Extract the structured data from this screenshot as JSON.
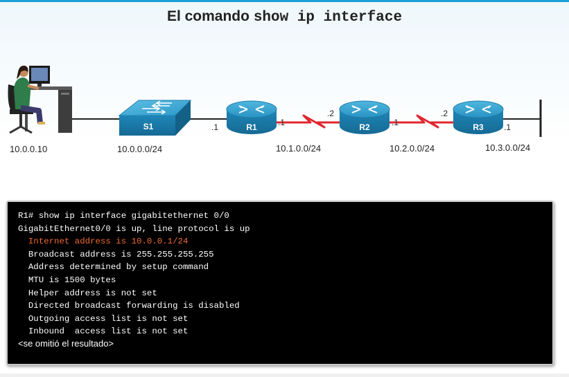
{
  "title": {
    "prefix": "El comando",
    "command": "show ip interface"
  },
  "devices": {
    "pc": {
      "address": "10.0.0.10"
    },
    "switch": {
      "label": "S1"
    },
    "routers": [
      {
        "label": "R1"
      },
      {
        "label": "R2"
      },
      {
        "label": "R3"
      }
    ]
  },
  "networks": [
    "10.0.0.0/24",
    "10.1.0.0/24",
    "10.2.0.0/24",
    "10.3.0.0/24"
  ],
  "interface_labels": {
    "r1_lan": ".1",
    "r1_wan": ".1",
    "r2_left": ".2",
    "r2_right": ".1",
    "r3_left": ".2",
    "r3_lan": ".1"
  },
  "terminal": {
    "lines": [
      {
        "text": "R1# show ip interface gigabitethernet 0/0",
        "style": "normal"
      },
      {
        "text": "GigabitEthernet0/0 is up, line protocol is up",
        "style": "normal"
      },
      {
        "text": "  Internet address is 10.0.0.1/24",
        "style": "highlight"
      },
      {
        "text": "  Broadcast address is 255.255.255.255",
        "style": "normal"
      },
      {
        "text": "  Address determined by setup command",
        "style": "normal"
      },
      {
        "text": "  MTU is 1500 bytes",
        "style": "normal"
      },
      {
        "text": "  Helper address is not set",
        "style": "normal"
      },
      {
        "text": "  Directed broadcast forwarding is disabled",
        "style": "normal"
      },
      {
        "text": "  Outgoing access list is not set",
        "style": "normal"
      },
      {
        "text": "  Inbound  access list is not set",
        "style": "normal"
      }
    ],
    "omitted": "<se omitió el resultado>"
  },
  "colors": {
    "router_blue": "#1f8fbf",
    "serial_red": "#e0262f",
    "highlight_orange": "#f26a2e",
    "terminal_bg": "#000000"
  }
}
